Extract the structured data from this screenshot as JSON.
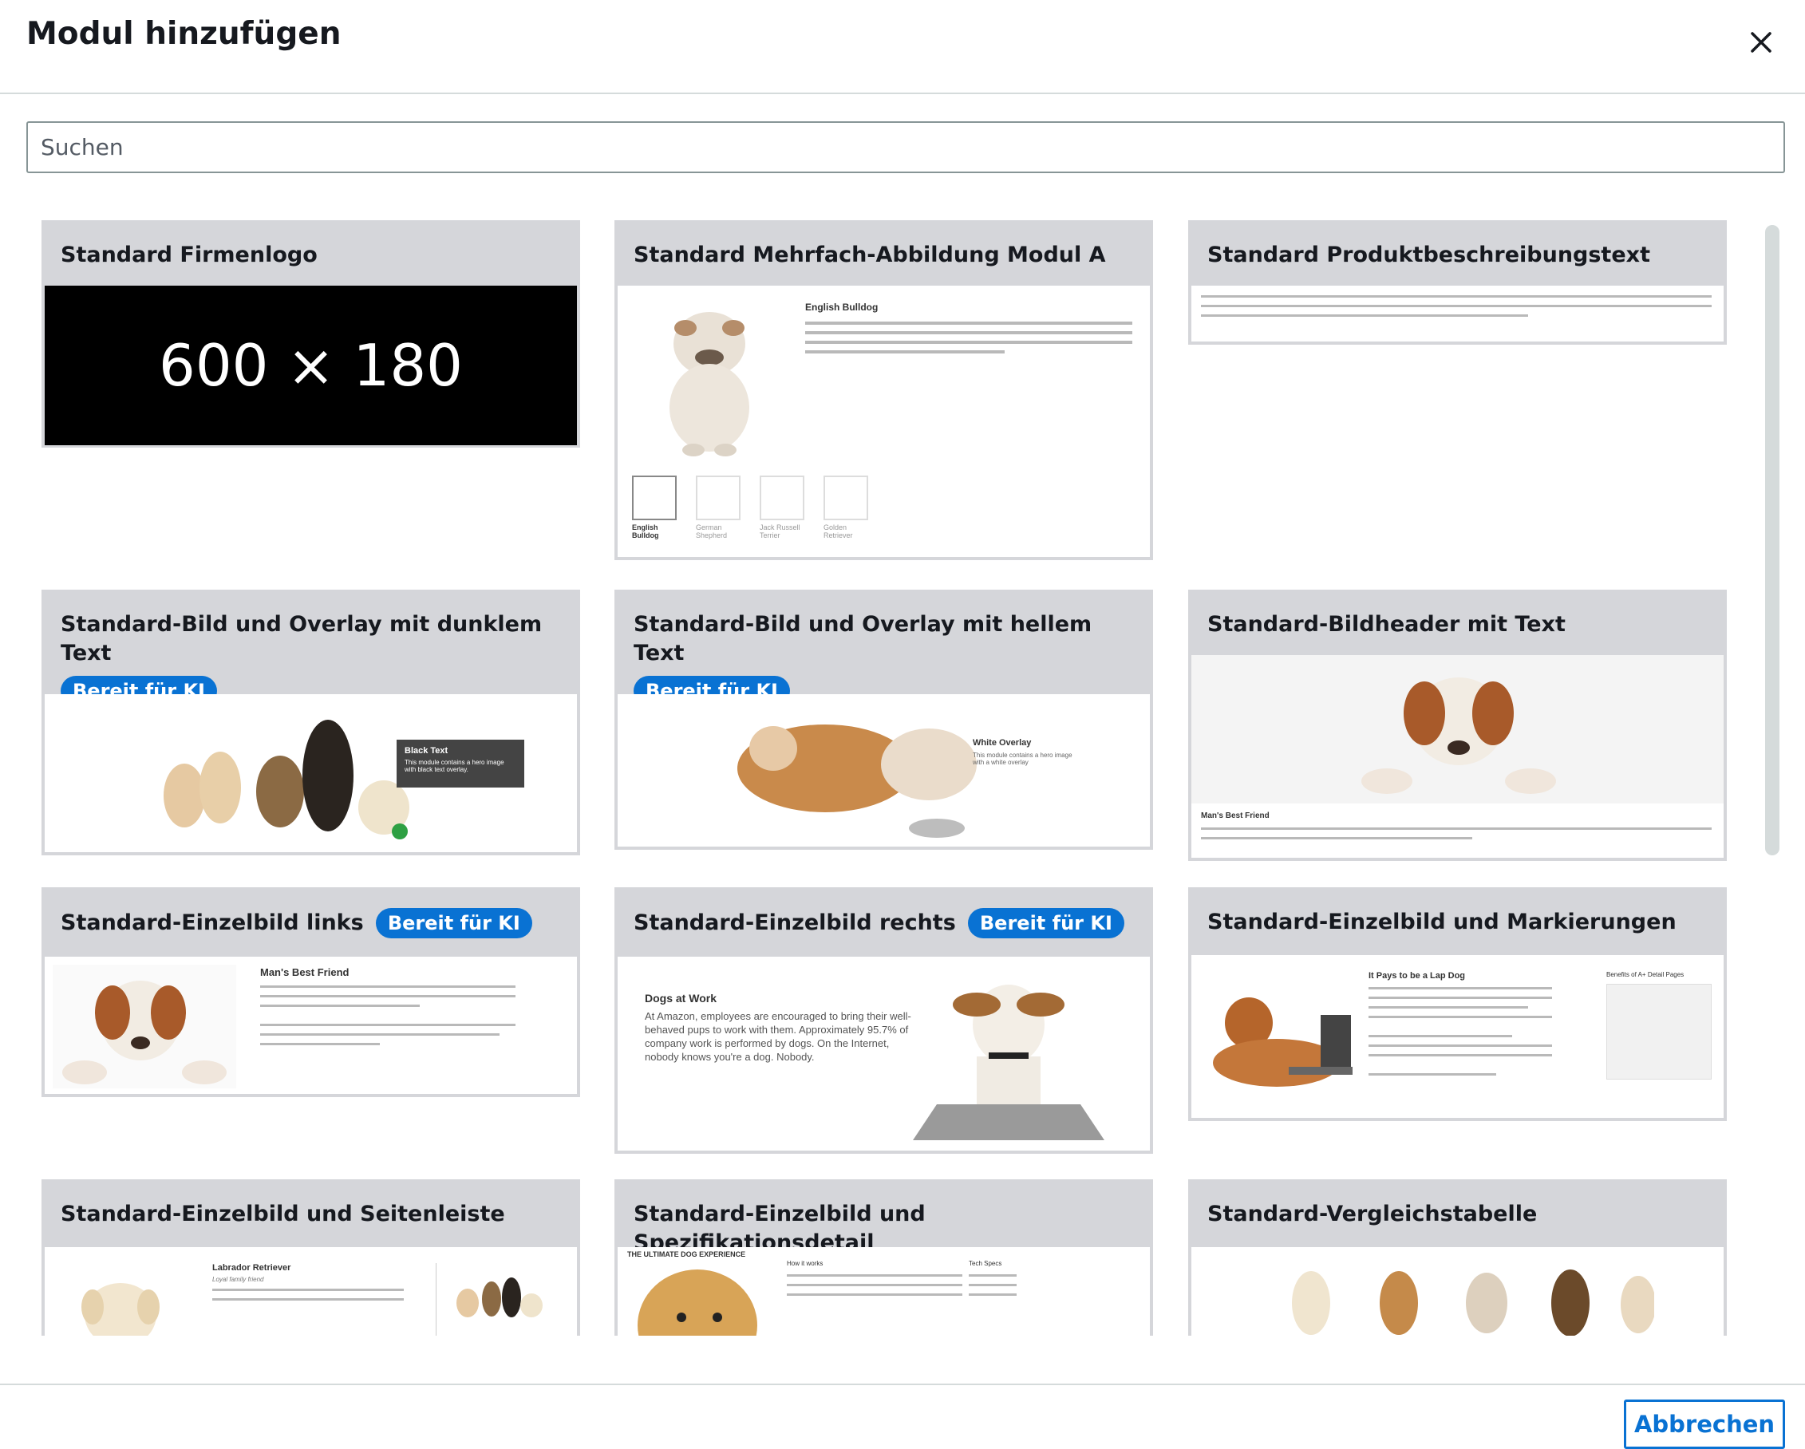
{
  "dialog": {
    "title": "Modul hinzufügen",
    "close_label": "×"
  },
  "search": {
    "placeholder": "Suchen"
  },
  "modules": [
    {
      "title": "Standard Firmenlogo",
      "badge": "",
      "preview": {
        "text": "600 × 180"
      }
    },
    {
      "title": "Standard Mehrfach-Abbildung Modul A",
      "badge": "",
      "preview": {
        "heading": "English Bulldog",
        "thumbs": [
          "English Bulldog",
          "German Shepherd",
          "Jack Russell Terrier",
          "Golden Retriever"
        ]
      }
    },
    {
      "title": "Standard Produktbeschreibungstext",
      "badge": "",
      "preview": {}
    },
    {
      "title": "Standard-Bild und Overlay mit dunklem Text",
      "badge": "Bereit für KI",
      "preview": {
        "heading": "Black Text",
        "text": "This module contains a hero image with black text overlay."
      }
    },
    {
      "title": "Standard-Bild und Overlay mit hellem Text",
      "badge": "Bereit für KI",
      "preview": {
        "heading": "White Overlay",
        "text": "This module contains a hero image with a white overlay"
      }
    },
    {
      "title": "Standard-Bildheader mit Text",
      "badge": "",
      "preview": {
        "heading": "Man's Best Friend"
      }
    },
    {
      "title": "Standard-Einzelbild links",
      "badge": "Bereit für KI",
      "preview": {
        "heading": "Man's Best Friend"
      }
    },
    {
      "title": "Standard-Einzelbild rechts",
      "badge": "Bereit für KI",
      "preview": {
        "heading": "Dogs at Work",
        "text": "At Amazon, employees are encouraged to bring their well-behaved pups to work with them. Approximately 95.7% of company work is performed by dogs. On the Internet, nobody knows you're a dog. Nobody."
      }
    },
    {
      "title": "Standard-Einzelbild und Markierungen",
      "badge": "",
      "preview": {
        "heading": "It Pays to be a Lap Dog",
        "side_heading": "Benefits of A+ Detail Pages"
      }
    },
    {
      "title": "Standard-Einzelbild und Seitenleiste",
      "badge": "",
      "preview": {
        "heading": "Labrador Retriever",
        "subheading": "Loyal family friend"
      }
    },
    {
      "title": "Standard-Einzelbild und Spezifikationsdetail",
      "badge": "",
      "preview": {
        "heading": "THE ULTIMATE DOG EXPERIENCE",
        "col1": "How it works",
        "col2": "Tech Specs"
      }
    },
    {
      "title": "Standard-Vergleichstabelle",
      "badge": "",
      "preview": {}
    }
  ],
  "footer": {
    "cancel_label": "Abbrechen"
  },
  "colors": {
    "accent": "#0972d3",
    "card_header": "#d5d6da",
    "border": "#d5dbdb"
  }
}
